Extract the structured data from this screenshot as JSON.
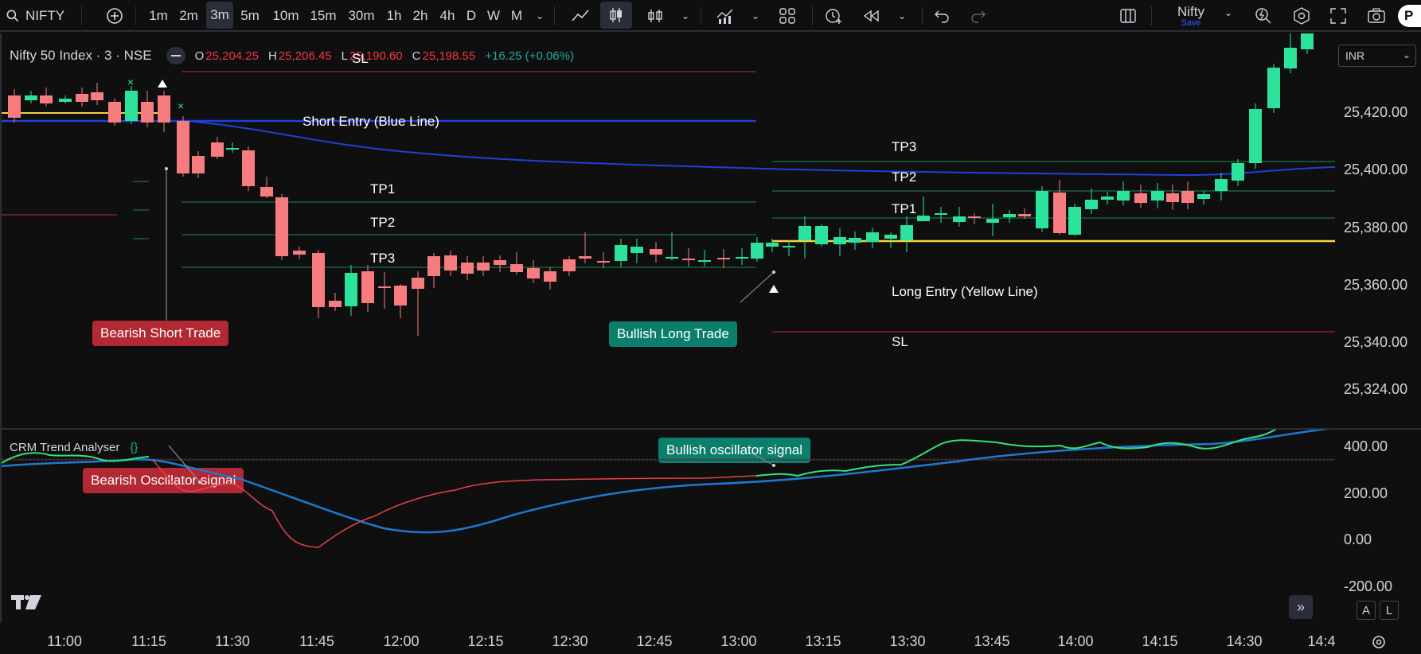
{
  "toolbar": {
    "symbol": "NIFTY",
    "intervals": [
      "1m",
      "2m",
      "3m",
      "5m",
      "10m",
      "15m",
      "30m",
      "1h",
      "2h",
      "4h",
      "D",
      "W",
      "M"
    ],
    "active_interval": "3m",
    "layout_name": "Nifty",
    "save_label": "Save",
    "profile_initial": "P"
  },
  "legend": {
    "title": "Nifty 50 Index · 3 · NSE",
    "open_key": "O",
    "open": "25,204.25",
    "high_key": "H",
    "high": "25,206.45",
    "low_key": "L",
    "low": "25,190.60",
    "close_key": "C",
    "close": "25,198.55",
    "change": "+16.25 (+0.06%)"
  },
  "currency": "INR",
  "price_axis": [
    "25,420.00",
    "25,400.00",
    "25,380.00",
    "25,360.00",
    "25,340.00",
    "25,324.00"
  ],
  "osc_axis": [
    "400.00",
    "200.00",
    "0.00",
    "-200.00"
  ],
  "time_axis": [
    "11:00",
    "11:15",
    "11:30",
    "11:45",
    "12:00",
    "12:15",
    "12:30",
    "12:45",
    "13:00",
    "13:15",
    "13:30",
    "13:45",
    "14:00",
    "14:15",
    "14:30",
    "14:4"
  ],
  "annotations": {
    "sl_top": "SL",
    "short_entry": "Short Entry (Blue Line)",
    "tp1_left": "TP1",
    "tp2_left": "TP2",
    "tp3_left": "TP3",
    "tp3_right": "TP3",
    "tp2_right": "TP2",
    "tp1_right": "TP1",
    "long_entry": "Long Entry (Yellow Line)",
    "sl_right": "SL",
    "bearish_trade": "Bearish  Short Trade",
    "bullish_trade": "Bullish Long Trade",
    "bearish_osc": "Bearish Oscillator signal",
    "bullish_osc": "Bullish oscillator signal"
  },
  "indicator": {
    "name": "CRM Trend Analyser",
    "brace": "{}"
  },
  "bottom_buttons": {
    "auto": "A",
    "log": "L"
  },
  "colors": {
    "bull": "#2de39b",
    "bear": "#f77c80",
    "ma_blue": "#1e40d8",
    "entry_yellow": "#f2d43c",
    "tp_green": "#1d8a55",
    "sl_red": "#c4283a",
    "osc_green": "#32e27b",
    "osc_red": "#e8404c",
    "osc_blue": "#1f78d0"
  }
}
